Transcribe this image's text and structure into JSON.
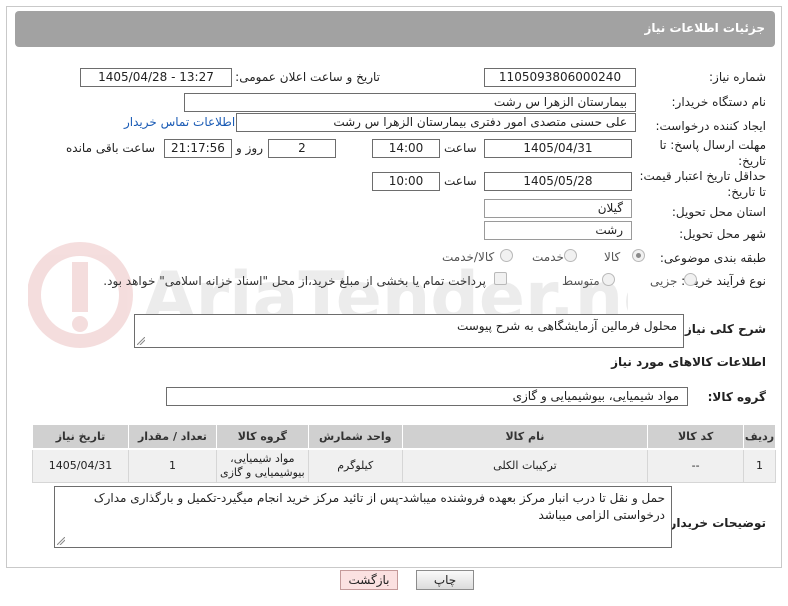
{
  "header": {
    "title": "جزئیات اطلاعات نیاز"
  },
  "watermark": {
    "text": "AriaTender.net"
  },
  "fields": {
    "need_number_label": "شماره نیاز:",
    "need_number": "1105093806000240",
    "announce_label": "تاریخ و ساعت اعلان عمومی:",
    "announce_value": "1405/04/28 - 13:27",
    "buyer_org_label": "نام دستگاه خریدار:",
    "buyer_org": "بیمارستان الزهرا  س  رشت",
    "creator_label": "ایجاد کننده درخواست:",
    "creator": "علی حسنی متصدی امور دفتری بیمارستان الزهرا  س  رشت",
    "contact_link": "اطلاعات تماس خریدار",
    "reply_deadline_label": "مهلت ارسال پاسخ: تا تاریخ:",
    "reply_date": "1405/04/31",
    "time_label": "ساعت",
    "reply_time": "14:00",
    "days": "2",
    "days_label": "روز و",
    "remaining": "21:17:56",
    "remaining_label": "ساعت باقی مانده",
    "price_deadline_label": "حداقل تاریخ اعتبار قیمت: تا تاریخ:",
    "price_date": "1405/05/28",
    "price_time": "10:00",
    "province_label": "استان محل تحویل:",
    "province": "گیلان",
    "city_label": "شهر محل تحویل:",
    "city": "رشت",
    "category_label": "طبقه بندی موضوعی:",
    "category_options": [
      "کالا",
      "خدمت",
      "کالا/خدمت"
    ],
    "category_selected": "کالا",
    "process_label": "نوع فرآیند خرید :",
    "process_options": [
      "جزیی",
      "متوسط"
    ],
    "payment_note": "پرداخت تمام یا بخشی از مبلغ خرید،از محل \"اسناد خزانه اسلامی\" خواهد بود."
  },
  "description": {
    "label": "شرح کلی نیاز:",
    "value": "محلول فرمالین آزمایشگاهی به شرح پیوست"
  },
  "goods": {
    "section_title": "اطلاعات کالاهای مورد نیاز",
    "group_label": "گروه کالا:",
    "group_value": "مواد شیمیایی، بیوشیمیایی و  گازی",
    "columns": [
      "ردیف",
      "کد کالا",
      "نام کالا",
      "واحد شمارش",
      "گروه کالا",
      "تعداد / مقدار",
      "تاریخ نیاز"
    ],
    "rows": [
      {
        "index": "1",
        "code": "--",
        "name": "ترکیبات الکلی",
        "unit": "کیلوگرم",
        "group": "مواد شیمیایی، بیوشیمیایی و گازی",
        "qty": "1",
        "date": "1405/04/31"
      }
    ]
  },
  "buyer_notes": {
    "label": "توضیحات خریدار:",
    "value": "حمل و نقل تا درب انبار مرکز بعهده فروشنده میباشد-پس از تائید مرکز خرید انجام میگیرد-تکمیل و بارگذاری مدارک درخواستی الزامی میباشد"
  },
  "buttons": {
    "print": "چاپ",
    "back": "بازگشت"
  }
}
